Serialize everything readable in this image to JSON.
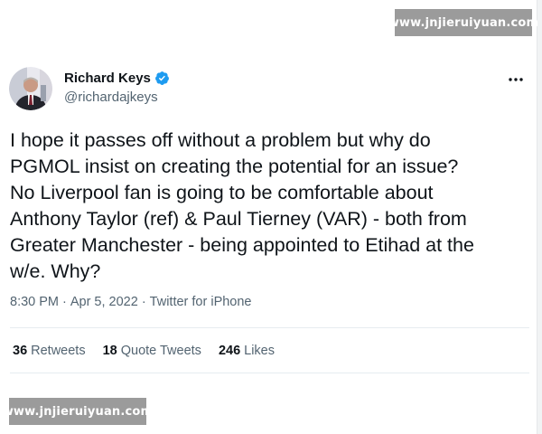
{
  "watermark": {
    "top_text": "www.jnjieruiyuan.com",
    "bottom_text": "www.jnjieruiyuan.com"
  },
  "author": {
    "name": "Richard Keys",
    "handle": "@richardajkeys",
    "verified": true
  },
  "tweet": {
    "text": "I hope it passes off without a problem but why do\nPGMOL insist on creating the potential for an issue?\nNo Liverpool fan is going to be comfortable about\nAnthony Taylor (ref) & Paul Tierney (VAR) - both from\nGreater Manchester - being appointed to Etihad at the\nw/e. Why?",
    "time": "8:30 PM",
    "date": "Apr 5, 2022",
    "source": "Twitter for iPhone",
    "separator": "·"
  },
  "stats": {
    "retweets_count": "36",
    "retweets_label": "Retweets",
    "quotes_count": "18",
    "quotes_label": "Quote Tweets",
    "likes_count": "246",
    "likes_label": "Likes"
  },
  "icons": {
    "verified": "verified-badge-icon",
    "more": "more-options-icon"
  },
  "colors": {
    "text": "#0f1419",
    "secondary": "#536471",
    "verified": "#1d9bf0",
    "watermark_bg": "#9b9b9b"
  }
}
